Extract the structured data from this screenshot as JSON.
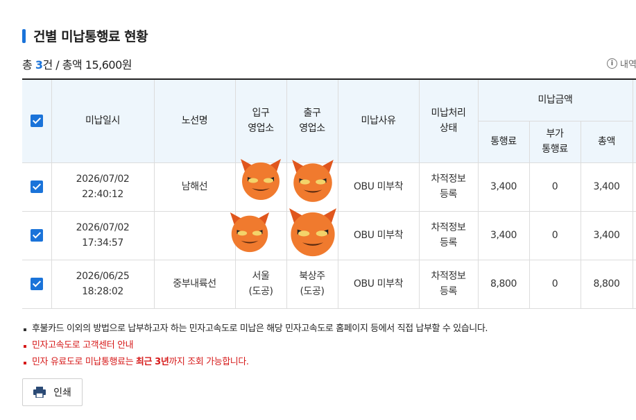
{
  "section": {
    "title": "건별 미납통행료 현황"
  },
  "summary": {
    "prefix": "총 ",
    "count": "3",
    "count_unit": "건 / 총액 ",
    "total": "15,600원"
  },
  "info_link": {
    "icon": "info-icon",
    "label": "내역"
  },
  "table": {
    "headers": {
      "date": "미납일시",
      "route": "노선명",
      "entry": "입구\n영업소",
      "exit": "출구\n영업소",
      "reason": "미납사유",
      "status": "미납처리\n상태",
      "amount_group": "미납금액",
      "toll": "통행료",
      "extra": "부가\n통행료",
      "total": "총액"
    },
    "rows": [
      {
        "checked": true,
        "date": "2026/07/02",
        "time": "22:40:12",
        "route": "남해선",
        "entry": "",
        "exit": "",
        "reason": "OBU 미부착",
        "status": "차적정보\n등록",
        "toll": "3,400",
        "extra": "0",
        "total": "3,400"
      },
      {
        "checked": true,
        "date": "2026/07/02",
        "time": "17:34:57",
        "route": "",
        "entry": "",
        "exit": "",
        "reason": "OBU 미부착",
        "status": "차적정보\n등록",
        "toll": "3,400",
        "extra": "0",
        "total": "3,400"
      },
      {
        "checked": true,
        "date": "2026/06/25",
        "time": "18:28:02",
        "route": "중부내륙선",
        "entry": "서울\n(도공)",
        "exit": "북상주\n(도공)",
        "reason": "OBU 미부착",
        "status": "차적정보\n등록",
        "toll": "8,800",
        "extra": "0",
        "total": "8,800"
      }
    ]
  },
  "notes": {
    "n1": "후불카드 이외의 방법으로 납부하고자 하는 민자고속도로 미납은 해당 민자고속도로 홈페이지 등에서 직접 납부할 수 있습니다.",
    "n2": "민자고속도로 고객센터 안내",
    "n3_pre": "민자 유료도로 미납통행료는 ",
    "n3_strong": "최근 3년",
    "n3_post": "까지 조회 가능합니다."
  },
  "print_button": {
    "icon": "printer-icon",
    "label": "인쇄"
  },
  "colors": {
    "accent": "#1a73d9",
    "header_bg": "#eef6fc",
    "notice_red": "#d61a1a"
  }
}
